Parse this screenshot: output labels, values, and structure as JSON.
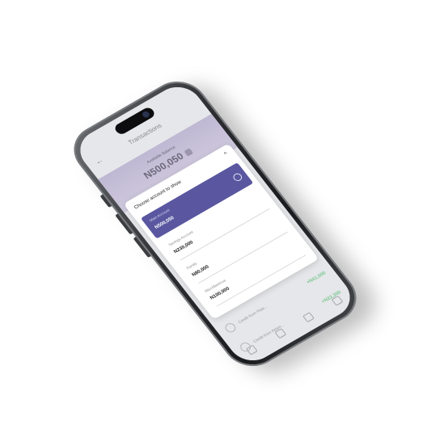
{
  "app": {
    "title": "Transactions",
    "balance_label": "Available Balance",
    "balance": "N500,050"
  },
  "sheet": {
    "title": "Choose account to show",
    "accounts": [
      {
        "name": "Main Account",
        "amount": "N500,050"
      },
      {
        "name": "Savings Account",
        "amount": "N230,000"
      },
      {
        "name": "Family",
        "amount": "N80,000"
      },
      {
        "name": "Miscellaneous",
        "amount": "N100,000"
      }
    ]
  },
  "transactions": [
    {
      "title": "Credit from Pete...",
      "amount": "+N41,000"
    },
    {
      "title": "Credit from Adam...",
      "amount": "+N22,300"
    }
  ],
  "colors": {
    "accent": "#5a57a0",
    "credit": "#7bc792"
  }
}
